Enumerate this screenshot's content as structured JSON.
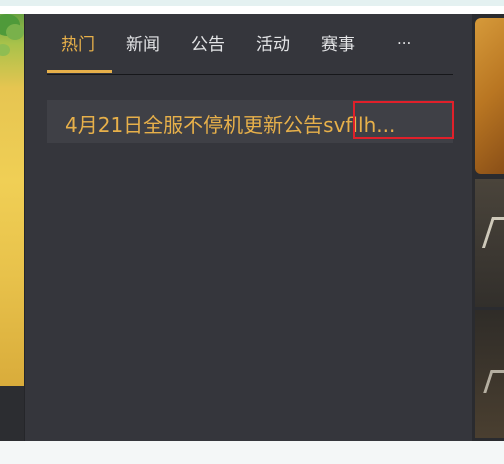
{
  "tabs": [
    {
      "label": "热门",
      "active": true
    },
    {
      "label": "新闻",
      "active": false
    },
    {
      "label": "公告",
      "active": false
    },
    {
      "label": "活动",
      "active": false
    },
    {
      "label": "赛事",
      "active": false
    },
    {
      "label": "...",
      "active": false
    }
  ],
  "news": [
    {
      "title": "4月21日全服不停机更新公告svfllh..."
    }
  ],
  "colors": {
    "accent": "#e7b04a",
    "panel_bg": "#35363c",
    "item_bg": "#3f4046",
    "highlight": "#e0202a"
  }
}
